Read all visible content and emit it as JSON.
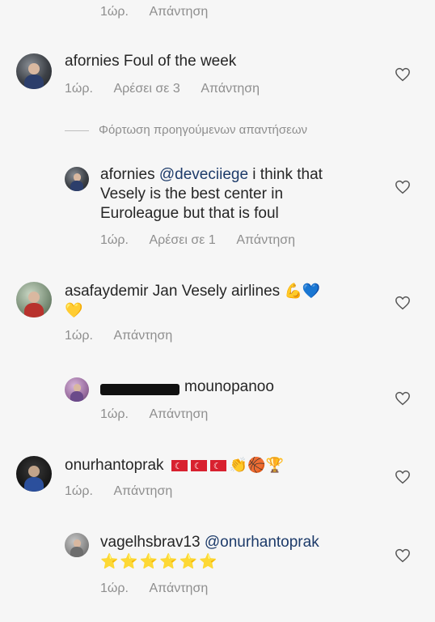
{
  "top": {
    "time": "1ώρ.",
    "reply": "Απάντηση"
  },
  "comments": [
    {
      "username": "afornies",
      "text": "Foul of the week",
      "time": "1ώρ.",
      "likes": "Αρέσει σε 3",
      "reply": "Απάντηση"
    }
  ],
  "load_previous": "Φόρτωση προηγούμενων απαντήσεων",
  "replies": [
    {
      "username": "afornies",
      "mention": "@deveciiege",
      "text_line1": " i think that",
      "text_line2": "Vesely is the best center in",
      "text_line3": "Euroleague but that is foul",
      "time": "1ώρ.",
      "likes": "Αρέσει σε 1",
      "reply": "Απάντηση"
    },
    {
      "username": "asafaydemir",
      "text": "Jan Vesely airlines",
      "emoji1": "💪💙",
      "emoji2": "💛",
      "time": "1ώρ.",
      "reply": "Απάντηση"
    },
    {
      "username_redacted": true,
      "text": "mounopanoo",
      "time": "1ώρ.",
      "reply": "Απάντηση"
    },
    {
      "username": "onurhantoprak",
      "emoji": "👏🏀🏆",
      "time": "1ώρ.",
      "reply": "Απάντηση"
    },
    {
      "username": "vagelhsbrav13",
      "mention": "@onurhantoprak",
      "stars": "⭐⭐⭐⭐⭐⭐",
      "time": "1ώρ.",
      "reply": "Απάντηση"
    }
  ],
  "icons": {
    "heart": "heart-outline-icon",
    "avatar": "avatar"
  },
  "colors": {
    "background": "#f6f6f6",
    "meta": "#8e8e8e",
    "mention": "#1d3b6a"
  }
}
